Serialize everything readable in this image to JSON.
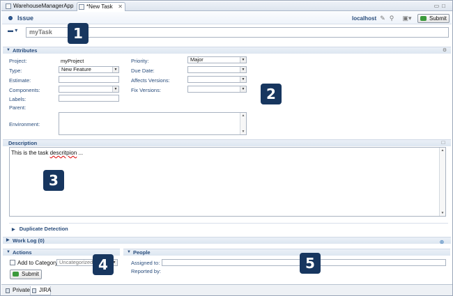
{
  "tabs": [
    {
      "label": "WarehouseManagerApp"
    },
    {
      "label": "*New Task"
    }
  ],
  "header": {
    "title": "Issue",
    "host": "localhost",
    "submit_label": "Submit"
  },
  "summary": {
    "value": "myTask"
  },
  "attributes": {
    "section_label": "Attributes",
    "project_label": "Project:",
    "project_value": "myProject",
    "type_label": "Type:",
    "type_value": "New Feature",
    "estimate_label": "Estimate:",
    "components_label": "Components:",
    "labels_label": "Labels:",
    "parent_label": "Parent:",
    "environment_label": "Environment:",
    "priority_label": "Priority:",
    "priority_value": "Major",
    "due_date_label": "Due Date:",
    "affects_label": "Affects Versions:",
    "fix_label": "Fix Versions:"
  },
  "description": {
    "section_label": "Description",
    "text_before": "This is the task ",
    "text_misspelled": "descritpion",
    "text_after": " ..."
  },
  "duplicate_detection": {
    "label": "Duplicate Detection"
  },
  "work_log": {
    "label": "Work Log (0)"
  },
  "actions": {
    "section_label": "Actions",
    "add_to_category_label": "Add to Category",
    "category_value": "Uncategorized",
    "submit_label": "Submit"
  },
  "people": {
    "section_label": "People",
    "assigned_to_label": "Assigned to:",
    "reported_by_label": "Reported by:"
  },
  "badges": [
    "1",
    "2",
    "3",
    "4",
    "5"
  ],
  "bottom_tabs": [
    {
      "label": "Private"
    },
    {
      "label": "JIRA"
    }
  ],
  "colors": {
    "accent": "#2a4d7c",
    "badge": "#17365f",
    "submit_icon": "#3c9a3c"
  }
}
